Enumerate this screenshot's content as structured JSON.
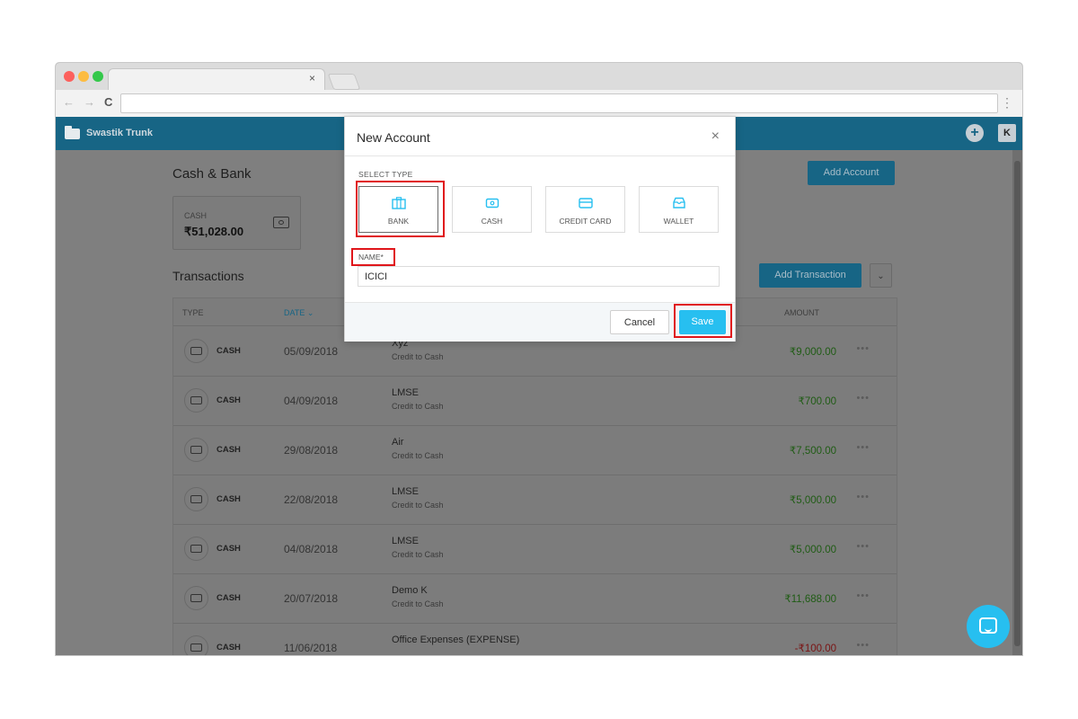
{
  "browser": {
    "tab_close": "×",
    "nav_back": "←",
    "nav_forward": "→",
    "nav_reload": "C",
    "menu": "⋮"
  },
  "app": {
    "brand": "Swastik Trunk",
    "avatar_initial": "K",
    "plus": "+"
  },
  "page": {
    "cash_bank_title": "Cash & Bank",
    "add_account_label": "Add Account",
    "account_card": {
      "label": "CASH",
      "amount": "₹51,028.00"
    },
    "transactions_title": "Transactions",
    "add_transaction_label": "Add Transaction",
    "dropdown_icon": "⌄"
  },
  "table": {
    "headers": {
      "type": "TYPE",
      "date": "DATE ⌄",
      "amount": "AMOUNT"
    },
    "rows": [
      {
        "type": "CASH",
        "date": "05/09/2018",
        "title": "Xyz",
        "sub": "Credit to Cash",
        "amount": "₹9,000.00",
        "more": "•••"
      },
      {
        "type": "CASH",
        "date": "04/09/2018",
        "title": "LMSE",
        "sub": "Credit to Cash",
        "amount": "₹700.00",
        "more": "•••"
      },
      {
        "type": "CASH",
        "date": "29/08/2018",
        "title": "Air",
        "sub": "Credit to Cash",
        "amount": "₹7,500.00",
        "more": "•••"
      },
      {
        "type": "CASH",
        "date": "22/08/2018",
        "title": "LMSE",
        "sub": "Credit to Cash",
        "amount": "₹5,000.00",
        "more": "•••"
      },
      {
        "type": "CASH",
        "date": "04/08/2018",
        "title": "LMSE",
        "sub": "Credit to Cash",
        "amount": "₹5,000.00",
        "more": "•••"
      },
      {
        "type": "CASH",
        "date": "20/07/2018",
        "title": "Demo K",
        "sub": "Credit to Cash",
        "amount": "₹11,688.00",
        "more": "•••"
      },
      {
        "type": "CASH",
        "date": "11/06/2018",
        "title": "Office Expenses (EXPENSE)",
        "sub": "",
        "amount": "-₹100.00",
        "more": "•••"
      }
    ]
  },
  "modal": {
    "title": "New Account",
    "close": "×",
    "select_type_label": "SELECT TYPE",
    "types": [
      {
        "label": "BANK",
        "icon": "bank-icon",
        "selected": true
      },
      {
        "label": "CASH",
        "icon": "cash-icon",
        "selected": false
      },
      {
        "label": "CREDIT CARD",
        "icon": "credit-card-icon",
        "selected": false
      },
      {
        "label": "WALLET",
        "icon": "wallet-icon",
        "selected": false
      }
    ],
    "name_label": "NAME*",
    "name_value": "ICICI",
    "cancel_label": "Cancel",
    "save_label": "Save"
  },
  "colors": {
    "appbar": "#176585",
    "accent": "#27bff0",
    "highlight": "#e0161b",
    "positive": "#1f5c14",
    "negative": "#7a1414"
  }
}
